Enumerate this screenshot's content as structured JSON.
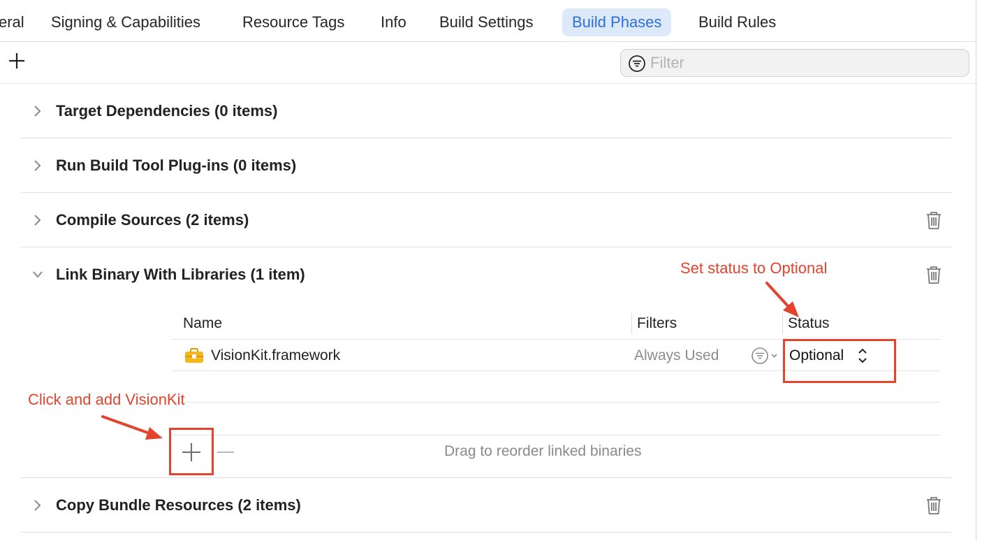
{
  "tabs": [
    {
      "label": "eral",
      "active": false
    },
    {
      "label": "Signing & Capabilities",
      "active": false
    },
    {
      "label": "Resource Tags",
      "active": false
    },
    {
      "label": "Info",
      "active": false
    },
    {
      "label": "Build Settings",
      "active": false
    },
    {
      "label": "Build Phases",
      "active": true
    },
    {
      "label": "Build Rules",
      "active": false
    }
  ],
  "toolbar": {
    "add_icon": "plus-icon",
    "filter_placeholder": "Filter",
    "filter_icon": "filter-circle-icon"
  },
  "phases": [
    {
      "title": "Target Dependencies (0 items)",
      "expanded": false,
      "deletable": false
    },
    {
      "title": "Run Build Tool Plug-ins (0 items)",
      "expanded": false,
      "deletable": false
    },
    {
      "title": "Compile Sources (2 items)",
      "expanded": false,
      "deletable": true
    },
    {
      "title": "Link Binary With Libraries (1 item)",
      "expanded": true,
      "deletable": true
    },
    {
      "title": "Copy Bundle Resources (2 items)",
      "expanded": false,
      "deletable": true
    }
  ],
  "library_table": {
    "columns": {
      "name": "Name",
      "filters": "Filters",
      "status": "Status"
    },
    "rows": [
      {
        "icon": "framework-toolbox-icon",
        "name": "VisionKit.framework",
        "filters": "Always Used",
        "status": "Optional"
      }
    ],
    "footer_hint": "Drag to reorder linked binaries"
  },
  "annotations": {
    "status_note": "Set status to Optional",
    "add_note": "Click and add VisionKit",
    "color": "#e4432d"
  },
  "colors": {
    "accent": "#2f6fdc",
    "active_tab_bg": "#dce9f9",
    "framework_icon": "#f4b81c"
  }
}
